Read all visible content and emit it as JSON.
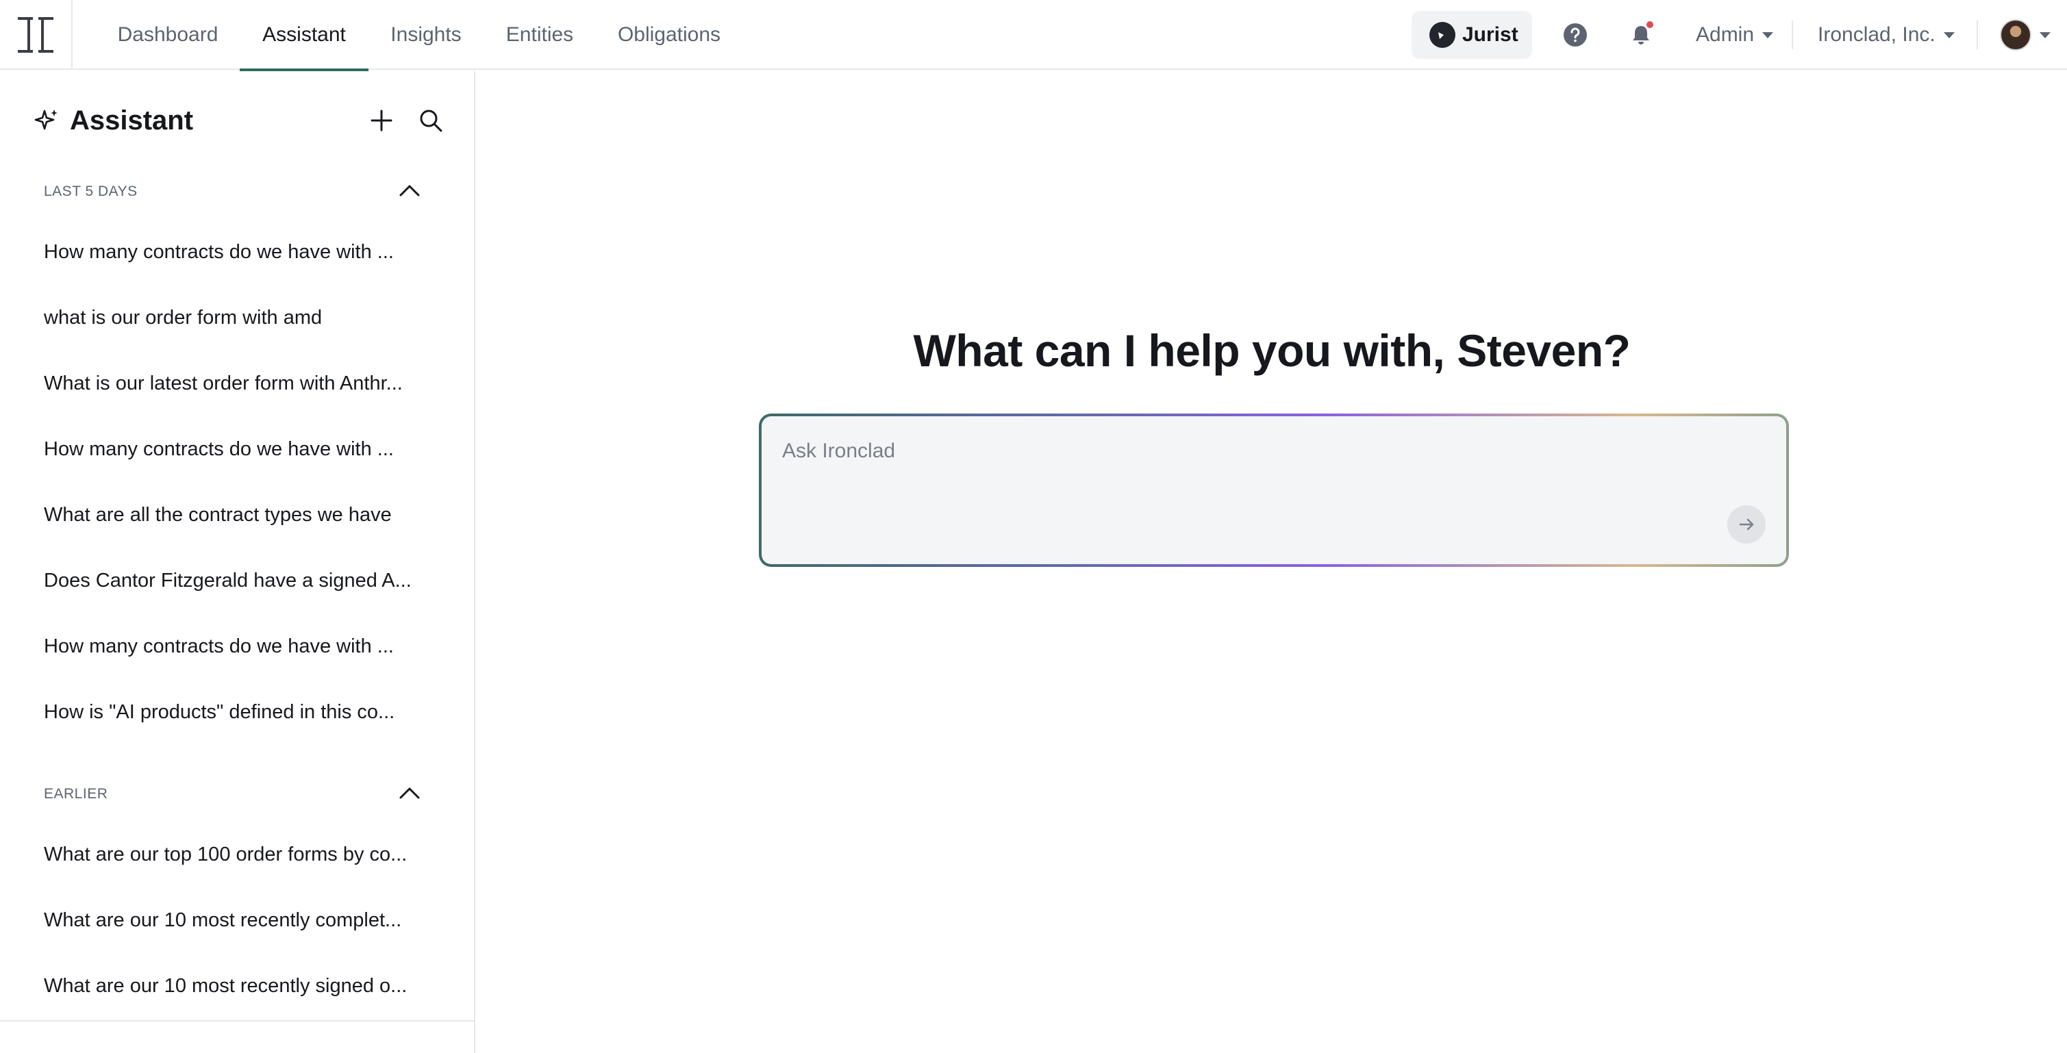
{
  "nav": {
    "tabs": [
      {
        "label": "Dashboard"
      },
      {
        "label": "Assistant"
      },
      {
        "label": "Insights"
      },
      {
        "label": "Entities"
      },
      {
        "label": "Obligations"
      }
    ],
    "active_tab": "Assistant",
    "jurist_label": "Jurist",
    "admin_label": "Admin",
    "org_label": "Ironclad, Inc.",
    "icons": [
      "ironclad-logo-icon",
      "help-icon",
      "bell-icon",
      "caret-down-icon"
    ],
    "notification_dot_color": "#e5484d"
  },
  "sidebar": {
    "title": "Assistant",
    "sections": [
      {
        "label": "LAST 5 DAYS",
        "items": [
          "How many contracts do we have with ...",
          "what is our order form with amd",
          "What is our latest order form with Anthr...",
          "How many contracts do we have with ...",
          "What are all the contract types we have",
          "Does Cantor Fitzgerald have a signed A...",
          "How many contracts do we have with ...",
          "How is \"AI products\" defined in this co..."
        ]
      },
      {
        "label": "EARLIER",
        "items": [
          "What are our top 100 order forms by co...",
          "What are our 10 most recently complet...",
          "What are our 10 most recently signed o..."
        ]
      }
    ]
  },
  "main": {
    "greeting": "What can I help you with, Steven?",
    "prompt_placeholder": "Ask Ironclad",
    "prompt_value": ""
  },
  "colors": {
    "accent": "#2e6b5e",
    "text": "#16181d",
    "muted": "#5d6370"
  }
}
